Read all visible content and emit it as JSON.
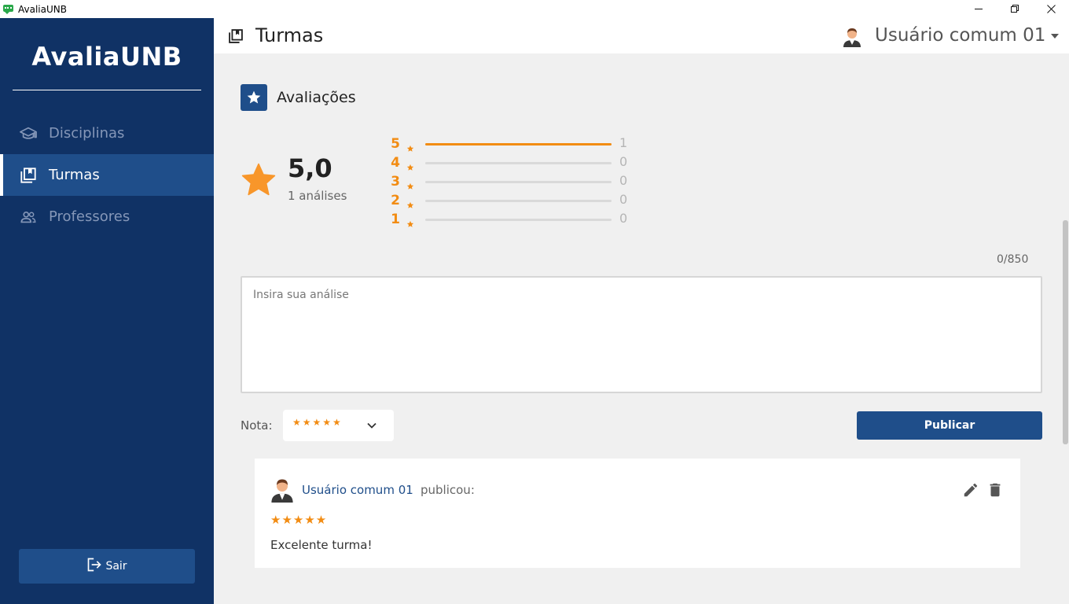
{
  "window": {
    "title": "AvaliaUNB",
    "icon": "chat-bubble-icon",
    "controls": [
      "minimize-icon",
      "restore-icon",
      "close-icon"
    ]
  },
  "sidebar": {
    "brand": "AvaliaUNB",
    "items": [
      {
        "label": "Disciplinas",
        "icon": "graduation-cap-icon",
        "active": false
      },
      {
        "label": "Turmas",
        "icon": "library-books-icon",
        "active": true
      },
      {
        "label": "Professores",
        "icon": "people-icon",
        "active": false
      }
    ],
    "logout_label": "Sair"
  },
  "header": {
    "title": "Turmas",
    "user_name": "Usuário comum 01"
  },
  "reviews": {
    "section_title": "Avaliações",
    "average": "5,0",
    "count_label": "1 análises",
    "distribution": [
      {
        "stars": "5",
        "count": "1",
        "fraction": 1.0
      },
      {
        "stars": "4",
        "count": "0",
        "fraction": 0
      },
      {
        "stars": "3",
        "count": "0",
        "fraction": 0
      },
      {
        "stars": "2",
        "count": "0",
        "fraction": 0
      },
      {
        "stars": "1",
        "count": "0",
        "fraction": 0
      }
    ]
  },
  "form": {
    "char_count": "0/850",
    "placeholder": "Insira sua análise",
    "value": "",
    "nota_label": "Nota:",
    "nota_value": "★★★★★",
    "publish_label": "Publicar"
  },
  "posted_review": {
    "author": "Usuário comum 01",
    "action": "publicou:",
    "rating": 5,
    "rating_stars": "★★★★★",
    "text": "Excelente turma!"
  },
  "colors": {
    "sidebar_bg": "#103265",
    "accent": "#1f4e8a",
    "star": "#f28c13"
  }
}
